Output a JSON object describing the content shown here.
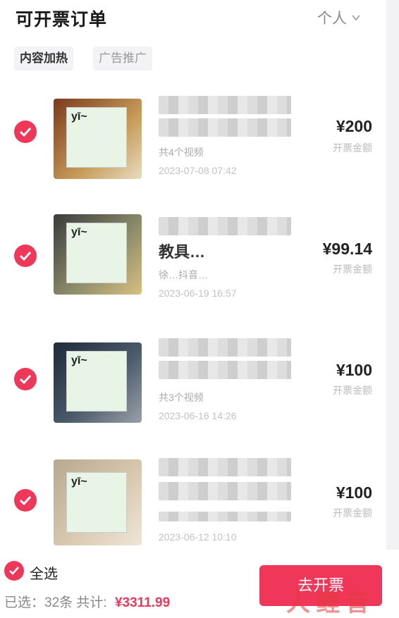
{
  "header": {
    "title": "可开票订单",
    "filter_label": "个人"
  },
  "tabs": [
    {
      "label": "内容加热"
    },
    {
      "label": "广告推广"
    }
  ],
  "orders": [
    {
      "title_line2": "",
      "sub": "共4个视频",
      "date": "2023-07-08 07:42",
      "amount": "¥200",
      "amount_label": "开票金额",
      "meme_text": "yī~"
    },
    {
      "title_line2": "教具…",
      "sub": "徐…抖音…",
      "date": "2023-06-19 16:57",
      "amount": "¥99.14",
      "amount_label": "开票金额",
      "meme_text": "yī~"
    },
    {
      "title_line2": "",
      "sub": "共3个视频",
      "date": "2023-06-16 14:26",
      "amount": "¥100",
      "amount_label": "开票金额",
      "meme_text": "yī~"
    },
    {
      "title_line2": "",
      "sub": "",
      "date": "2023-06-12 10:10",
      "amount": "¥100",
      "amount_label": "开票金额",
      "meme_text": "yī~"
    }
  ],
  "footer": {
    "select_all": "全选",
    "selected_label": "已选：32条",
    "total_label": "共计:",
    "total_value": "¥3311.99",
    "invoice_button": "去开票"
  },
  "colors": {
    "accent": "#f0375a"
  }
}
